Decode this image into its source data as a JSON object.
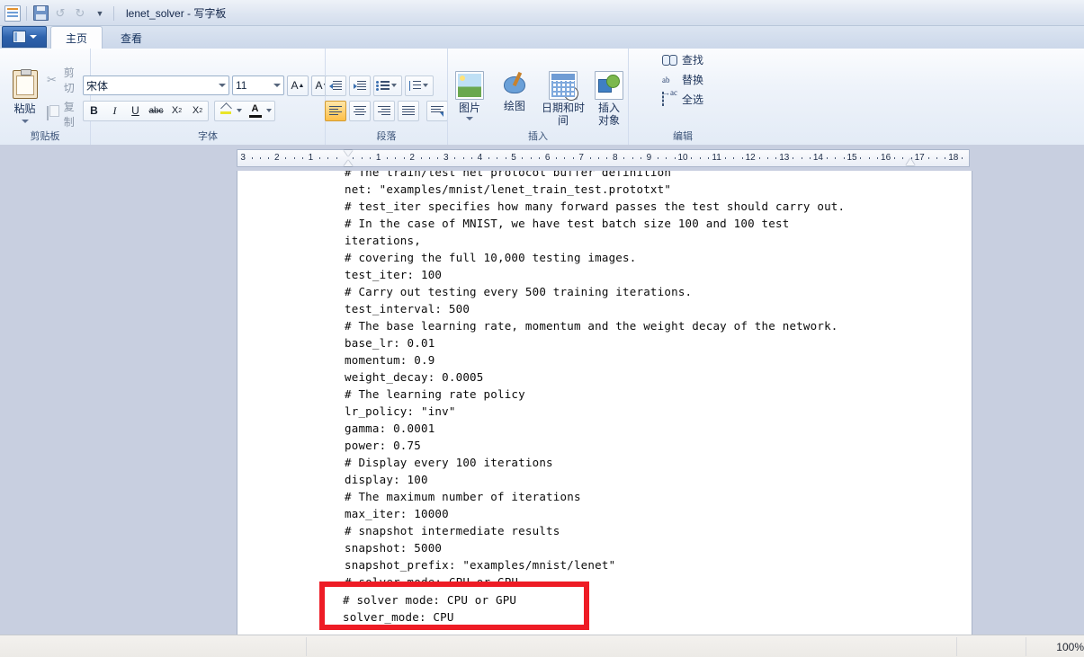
{
  "window": {
    "title": "lenet_solver - 写字板",
    "quick_access": [
      {
        "name": "app-icon",
        "label": ""
      },
      {
        "name": "save-icon",
        "label": ""
      },
      {
        "name": "undo-icon",
        "label": "↰"
      },
      {
        "name": "redo-icon",
        "label": "↱"
      },
      {
        "name": "customize-qat-icon",
        "label": "▾"
      }
    ]
  },
  "tabs": {
    "menu_button": "",
    "items": [
      {
        "label": "主页",
        "active": true
      },
      {
        "label": "查看",
        "active": false
      }
    ]
  },
  "ribbon": {
    "clipboard": {
      "group_label": "剪贴板",
      "paste": "粘贴",
      "cut": "剪切",
      "copy": "复制"
    },
    "font": {
      "group_label": "字体",
      "font_name": "宋体",
      "font_size": "11",
      "grow_font": "A",
      "shrink_font": "A",
      "bold": "B",
      "italic": "I",
      "underline": "U",
      "strikethrough": "abc",
      "subscript": "X",
      "superscript": "X",
      "highlight": "",
      "font_color": "A"
    },
    "paragraph": {
      "group_label": "段落",
      "decrease_indent": "",
      "increase_indent": "",
      "bullets": "",
      "line_spacing": "",
      "align_left": "",
      "align_center": "",
      "align_right": "",
      "align_justify": "",
      "paragraph_settings": ""
    },
    "insert": {
      "group_label": "插入",
      "items": [
        {
          "label": "图片",
          "icon": "picture-icon"
        },
        {
          "label": "绘图",
          "icon": "paint-drawing-icon"
        },
        {
          "label": "日期和时间",
          "icon": "date-time-icon"
        },
        {
          "label": "插入\n对象",
          "icon": "insert-object-icon"
        }
      ]
    },
    "editing": {
      "group_label": "编辑",
      "find": "查找",
      "replace": "替换",
      "select_all": "全选"
    }
  },
  "ruler": {
    "left_ticks": [
      "3",
      "2",
      "1"
    ],
    "right_ticks": [
      "1",
      "2",
      "3",
      "4",
      "5",
      "6",
      "7",
      "8",
      "9",
      "10",
      "11",
      "12",
      "13",
      "14",
      "15",
      "16",
      "17",
      "18"
    ]
  },
  "document": {
    "lines": [
      "# The train/test net protocol buffer definition",
      "net: \"examples/mnist/lenet_train_test.prototxt\"",
      "# test_iter specifies how many forward passes the test should carry out.",
      "# In the case of MNIST, we have test batch size 100 and 100 test",
      "iterations,",
      "# covering the full 10,000 testing images.",
      "test_iter: 100",
      "# Carry out testing every 500 training iterations.",
      "test_interval: 500",
      "# The base learning rate, momentum and the weight decay of the network.",
      "base_lr: 0.01",
      "momentum: 0.9",
      "weight_decay: 0.0005",
      "# The learning rate policy",
      "lr_policy: \"inv\"",
      "gamma: 0.0001",
      "power: 0.75",
      "# Display every 100 iterations",
      "display: 100",
      "# The maximum number of iterations",
      "max_iter: 10000",
      "# snapshot intermediate results",
      "snapshot: 5000",
      "snapshot_prefix: \"examples/mnist/lenet\"",
      "# solver mode: CPU or GPU",
      "solver_mode: CPU"
    ]
  },
  "annotation": {
    "color": "#ee1c25",
    "lines": [
      "# solver mode: CPU or GPU",
      "solver_mode: CPU"
    ]
  },
  "statusbar": {
    "zoom": "100%"
  }
}
